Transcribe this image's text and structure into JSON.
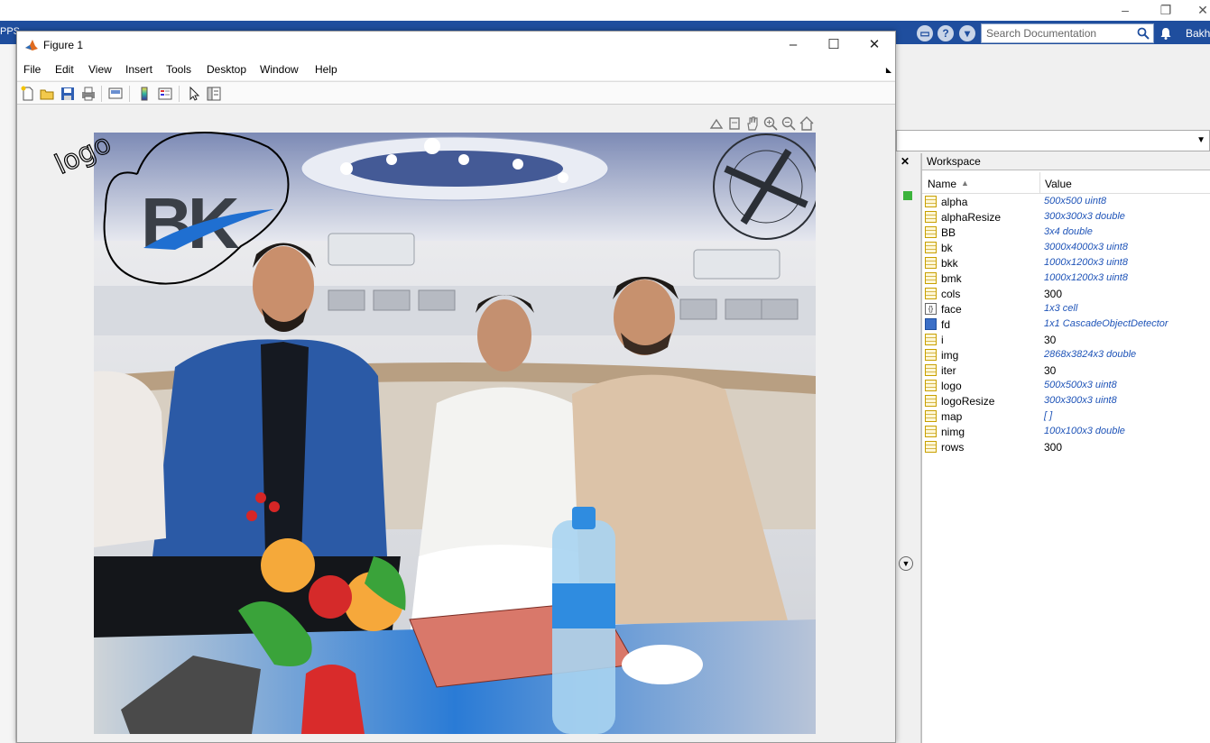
{
  "desktop": {
    "apps_tab_label": "PPS",
    "search": {
      "placeholder": "Search Documentation"
    },
    "user_name": "Bakh"
  },
  "figure": {
    "title": "Figure 1",
    "menus": [
      "File",
      "Edit",
      "View",
      "Insert",
      "Tools",
      "Desktop",
      "Window",
      "Help"
    ],
    "annotation_text": "logo",
    "logo_text": "BK"
  },
  "workspace": {
    "title": "Workspace",
    "columns": {
      "name": "Name",
      "value": "Value"
    },
    "variables": [
      {
        "name": "alpha",
        "value": "500x500 uint8",
        "icon": "matrix-icon"
      },
      {
        "name": "alphaResize",
        "value": "300x300x3 double",
        "icon": "matrix-icon"
      },
      {
        "name": "BB",
        "value": "3x4 double",
        "icon": "matrix-icon"
      },
      {
        "name": "bk",
        "value": "3000x4000x3 uint8",
        "icon": "matrix-icon"
      },
      {
        "name": "bkk",
        "value": "1000x1200x3 uint8",
        "icon": "matrix-icon"
      },
      {
        "name": "bmk",
        "value": "1000x1200x3 uint8",
        "icon": "matrix-icon"
      },
      {
        "name": "cols",
        "value": "300",
        "icon": "matrix-icon"
      },
      {
        "name": "face",
        "value": "1x3 cell",
        "icon": "cell-icon"
      },
      {
        "name": "fd",
        "value": "1x1 CascadeObjectDetector",
        "icon": "object-icon"
      },
      {
        "name": "i",
        "value": "30",
        "icon": "matrix-icon"
      },
      {
        "name": "img",
        "value": "2868x3824x3 double",
        "icon": "matrix-icon"
      },
      {
        "name": "iter",
        "value": "30",
        "icon": "matrix-icon"
      },
      {
        "name": "logo",
        "value": "500x500x3 uint8",
        "icon": "matrix-icon"
      },
      {
        "name": "logoResize",
        "value": "300x300x3 uint8",
        "icon": "matrix-icon"
      },
      {
        "name": "map",
        "value": "[ ]",
        "icon": "matrix-icon"
      },
      {
        "name": "nimg",
        "value": "100x100x3 double",
        "icon": "matrix-icon"
      },
      {
        "name": "rows",
        "value": "300",
        "icon": "matrix-icon"
      }
    ]
  },
  "colors": {
    "toolstrip": "#1f4e9e",
    "logo_dark": "#3a3f47",
    "logo_blue": "#1f6fd1",
    "value_blue": "#1f54b8"
  }
}
